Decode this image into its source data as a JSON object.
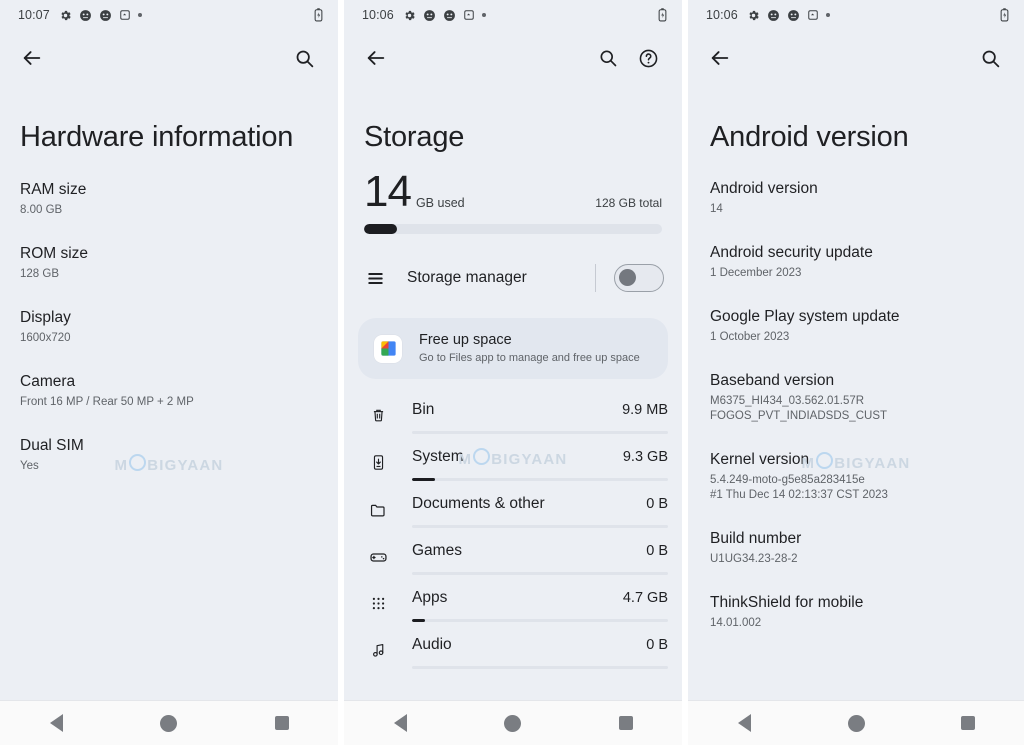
{
  "panel1": {
    "status_bar": {
      "time": "10:07",
      "icons": [
        "gear-icon",
        "moto-assist-icon",
        "moto-assist-icon",
        "screenshot-icon",
        "dot-icon"
      ],
      "battery": "battery-icon"
    },
    "app_bar": {
      "back": "back-arrow-icon",
      "search": "search-icon"
    },
    "title": "Hardware information",
    "items": [
      {
        "label": "RAM size",
        "value": "8.00 GB"
      },
      {
        "label": "ROM size",
        "value": "128 GB"
      },
      {
        "label": "Display",
        "value": "1600x720"
      },
      {
        "label": "Camera",
        "value": "Front 16 MP / Rear 50 MP + 2 MP"
      },
      {
        "label": "Dual SIM",
        "value": "Yes"
      }
    ]
  },
  "panel2": {
    "status_bar": {
      "time": "10:06",
      "icons": [
        "gear-icon",
        "moto-assist-icon",
        "moto-assist-icon",
        "screenshot-icon",
        "dot-icon"
      ],
      "battery": "battery-icon"
    },
    "app_bar": {
      "back": "back-arrow-icon",
      "search": "search-icon",
      "help": "help-icon"
    },
    "title": "Storage",
    "summary": {
      "used_number": "14",
      "used_unit": "GB used",
      "total": "128 GB total",
      "used_percent": 11
    },
    "storage_manager": {
      "label": "Storage manager",
      "icon": "list-icon",
      "toggle_on": false
    },
    "free_up_space": {
      "title": "Free up space",
      "subtitle": "Go to Files app to manage and free up space",
      "icon": "files-app-icon"
    },
    "categories": [
      {
        "icon": "trash-icon",
        "name": "Bin",
        "size": "9.9 MB",
        "percent": 0
      },
      {
        "icon": "system-icon",
        "name": "System",
        "size": "9.3 GB",
        "percent": 9
      },
      {
        "icon": "folder-icon",
        "name": "Documents & other",
        "size": "0 B",
        "percent": 0
      },
      {
        "icon": "gamepad-icon",
        "name": "Games",
        "size": "0 B",
        "percent": 0
      },
      {
        "icon": "apps-grid-icon",
        "name": "Apps",
        "size": "4.7 GB",
        "percent": 5
      },
      {
        "icon": "audio-icon",
        "name": "Audio",
        "size": "0 B",
        "percent": 0
      }
    ]
  },
  "panel3": {
    "status_bar": {
      "time": "10:06",
      "icons": [
        "gear-icon",
        "moto-assist-icon",
        "moto-assist-icon",
        "screenshot-icon",
        "dot-icon"
      ],
      "battery": "battery-icon"
    },
    "app_bar": {
      "back": "back-arrow-icon",
      "search": "search-icon"
    },
    "title": "Android version",
    "items": [
      {
        "label": "Android version",
        "value": "14"
      },
      {
        "label": "Android security update",
        "value": "1 December 2023"
      },
      {
        "label": "Google Play system update",
        "value": "1 October 2023"
      },
      {
        "label": "Baseband version",
        "value": "M6375_HI434_03.562.01.57R\nFOGOS_PVT_INDIADSDS_CUST"
      },
      {
        "label": "Kernel version",
        "value": "5.4.249-moto-g5e85a283415e\n#1 Thu Dec 14 02:13:37 CST 2023"
      },
      {
        "label": "Build number",
        "value": "U1UG34.23-28-2"
      },
      {
        "label": "ThinkShield for mobile",
        "value": "14.01.002"
      }
    ]
  },
  "nav_bar": {
    "back": "nav-back-icon",
    "home": "nav-home-icon",
    "recents": "nav-recents-icon"
  },
  "watermark": {
    "part1": "M",
    "part2": "BIGYAAN"
  },
  "colors": {
    "background": "#eceff4",
    "text_primary": "#1f2023",
    "text_secondary": "#5f6368",
    "bar_fill": "#1c1d21",
    "bar_track": "#dfe3ea",
    "card": "#e2e7ef",
    "navbar": "#fafafa"
  }
}
